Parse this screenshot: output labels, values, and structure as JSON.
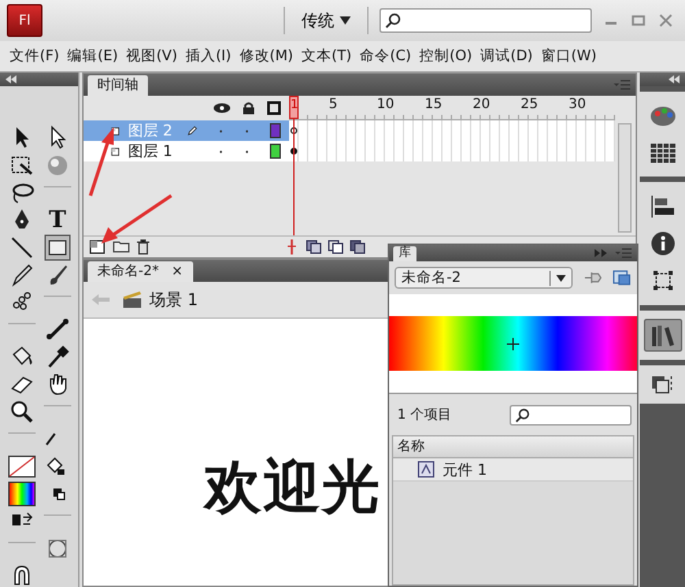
{
  "app": {
    "logo": "Fl",
    "workspace": "传统"
  },
  "menu": [
    "文件(F)",
    "编辑(E)",
    "视图(V)",
    "插入(I)",
    "修改(M)",
    "文本(T)",
    "命令(C)",
    "控制(O)",
    "调试(D)",
    "窗口(W)"
  ],
  "toolbox": {
    "text_tool": "T"
  },
  "timeline": {
    "tab": "时间轴",
    "current_frame": "1",
    "frame_numbers": [
      "5",
      "10",
      "15",
      "20",
      "25",
      "30"
    ],
    "layers": [
      {
        "name": "图层 2",
        "selected": true,
        "editing": true,
        "color": "#7030c0",
        "keyframe_filled": false
      },
      {
        "name": "图层 1",
        "selected": false,
        "editing": false,
        "color": "#40d040",
        "keyframe_filled": true
      }
    ]
  },
  "document": {
    "tab": "未命名-2*",
    "close": "×",
    "scene": "场景 1",
    "stage_text": "欢迎光"
  },
  "library": {
    "tab": "库",
    "document": "未命名-2",
    "item_count": "1 个项目",
    "column": "名称",
    "items": [
      {
        "name": "元件 1"
      }
    ]
  }
}
